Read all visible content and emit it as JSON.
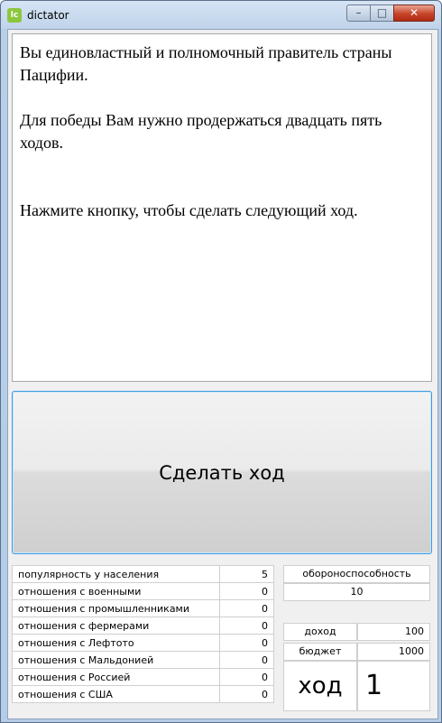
{
  "window": {
    "title": "dictator",
    "icon_text": "lc",
    "controls": {
      "minimize": "–",
      "maximize": "□",
      "close": "✕"
    }
  },
  "message": {
    "line1": "Вы единовластный и полномочный правитель страны Пацифии.",
    "line2": "Для победы Вам нужно продержаться двадцать пять ходов.",
    "line3": "Нажмите кнопку, чтобы сделать следующий ход."
  },
  "turn_button": {
    "label": "Сделать ход"
  },
  "relations": [
    {
      "label": "популярность у населения",
      "value": "5"
    },
    {
      "label": "отношения с военными",
      "value": "0"
    },
    {
      "label": "отношения с промышленниками",
      "value": "0"
    },
    {
      "label": "отношения с фермерами",
      "value": "0"
    },
    {
      "label": "отношения с Лефтото",
      "value": "0"
    },
    {
      "label": "отношения с Мальдонией",
      "value": "0"
    },
    {
      "label": "отношения с Россией",
      "value": "0"
    },
    {
      "label": "отношения с США",
      "value": "0"
    }
  ],
  "defense": {
    "label": "обороноспособность",
    "value": "10"
  },
  "finance": {
    "income_label": "доход",
    "income_value": "100",
    "budget_label": "бюджет",
    "budget_value": "1000"
  },
  "turn": {
    "label": "ход",
    "value": "1"
  }
}
